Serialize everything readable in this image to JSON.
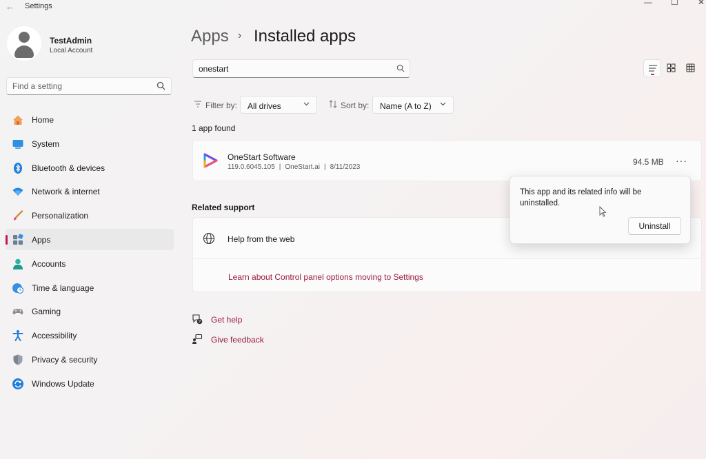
{
  "window": {
    "title": "Settings",
    "back_glyph": "←",
    "minimize": "—",
    "maximize": "☐",
    "close": "✕"
  },
  "account": {
    "name": "TestAdmin",
    "type": "Local Account"
  },
  "search_setting": {
    "placeholder": "Find a setting"
  },
  "nav": [
    {
      "label": "Home",
      "icon": "home-icon"
    },
    {
      "label": "System",
      "icon": "system-icon"
    },
    {
      "label": "Bluetooth & devices",
      "icon": "bluetooth-icon"
    },
    {
      "label": "Network & internet",
      "icon": "wifi-icon"
    },
    {
      "label": "Personalization",
      "icon": "brush-icon"
    },
    {
      "label": "Apps",
      "icon": "apps-icon",
      "active": true
    },
    {
      "label": "Accounts",
      "icon": "accounts-icon"
    },
    {
      "label": "Time & language",
      "icon": "clock-globe-icon"
    },
    {
      "label": "Gaming",
      "icon": "gamepad-icon"
    },
    {
      "label": "Accessibility",
      "icon": "accessibility-icon"
    },
    {
      "label": "Privacy & security",
      "icon": "shield-icon"
    },
    {
      "label": "Windows Update",
      "icon": "update-icon"
    }
  ],
  "breadcrumb": {
    "parent": "Apps",
    "separator": "›",
    "current": "Installed apps"
  },
  "app_search": {
    "value": "onestart"
  },
  "filter": {
    "label": "Filter by:",
    "value": "All drives"
  },
  "sort": {
    "label": "Sort by:",
    "value": "Name (A to Z)"
  },
  "results_count": "1 app found",
  "app": {
    "name": "OneStart Software",
    "version": "119.0.6045.105",
    "publisher": "OneStart.ai",
    "date": "8/11/2023",
    "separator": "|",
    "size": "94.5 MB",
    "more": "···"
  },
  "related_support": {
    "heading": "Related support",
    "help_from_web": "Help from the web",
    "learn_link": "Learn about Control panel options moving to Settings"
  },
  "footer_links": {
    "get_help": "Get help",
    "give_feedback": "Give feedback"
  },
  "uninstall_popup": {
    "message": "This app and its related info will be uninstalled.",
    "button": "Uninstall"
  },
  "colors": {
    "accent": "#c1155a",
    "link": "#9b1b3d"
  }
}
